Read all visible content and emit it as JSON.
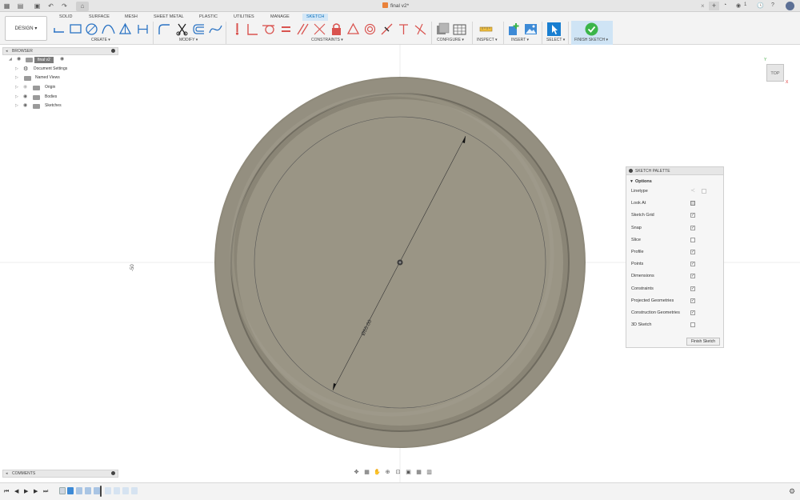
{
  "titlebar": {
    "document_title": "final v2*",
    "close_tab": "×",
    "add_tab": "+",
    "notification_count": "1"
  },
  "toolbar": {
    "workspace": "DESIGN",
    "tabs": [
      {
        "label": "SOLID",
        "active": false
      },
      {
        "label": "SURFACE",
        "active": false
      },
      {
        "label": "MESH",
        "active": false
      },
      {
        "label": "SHEET METAL",
        "active": false
      },
      {
        "label": "PLASTIC",
        "active": false
      },
      {
        "label": "UTILITIES",
        "active": false
      },
      {
        "label": "MANAGE",
        "active": false
      },
      {
        "label": "SKETCH",
        "active": true
      }
    ],
    "groups": {
      "create": "CREATE ▾",
      "modify": "MODIFY ▾",
      "constraints": "CONSTRAINTS ▾",
      "configure": "CONFIGURE ▾",
      "inspect": "INSPECT ▾",
      "insert": "INSERT ▾",
      "select": "SELECT ▾",
      "finish_sketch": "FINISH SKETCH ▾"
    }
  },
  "browser": {
    "title": "BROWSER",
    "root": "final v2",
    "items": [
      {
        "label": "Document Settings",
        "icon": "gear-icon"
      },
      {
        "label": "Named Views",
        "icon": "folder-icon"
      },
      {
        "label": "Origin",
        "icon": "folder-icon"
      },
      {
        "label": "Bodies",
        "icon": "folder-icon"
      },
      {
        "label": "Sketches",
        "icon": "folder-icon"
      }
    ]
  },
  "canvas": {
    "dimension_label": "Ø55.00",
    "axis_label": "-50"
  },
  "viewcube": {
    "face": "TOP",
    "y_axis": "Y",
    "x_axis": "X"
  },
  "sketch_palette": {
    "title": "SKETCH PALETTE",
    "section": "Options",
    "options": [
      {
        "label": "Linetype",
        "control": "linetype-icons"
      },
      {
        "label": "Look At",
        "control": "look-at-icon"
      },
      {
        "label": "Sketch Grid",
        "checked": true
      },
      {
        "label": "Snap",
        "checked": true
      },
      {
        "label": "Slice",
        "checked": false
      },
      {
        "label": "Profile",
        "checked": true
      },
      {
        "label": "Points",
        "checked": true
      },
      {
        "label": "Dimensions",
        "checked": true
      },
      {
        "label": "Constraints",
        "checked": true
      },
      {
        "label": "Projected Geometries",
        "checked": true
      },
      {
        "label": "Construction Geometries",
        "checked": true
      },
      {
        "label": "3D Sketch",
        "checked": false
      }
    ],
    "finish_button": "Finish Sketch"
  },
  "comments": {
    "title": "COMMENTS"
  },
  "colors": {
    "accent": "#0b6fba",
    "finish_green": "#3bb54a",
    "body_outer": "#8f8a7b",
    "body_inner": "#9a9585",
    "constraint_red": "#d9534f"
  }
}
